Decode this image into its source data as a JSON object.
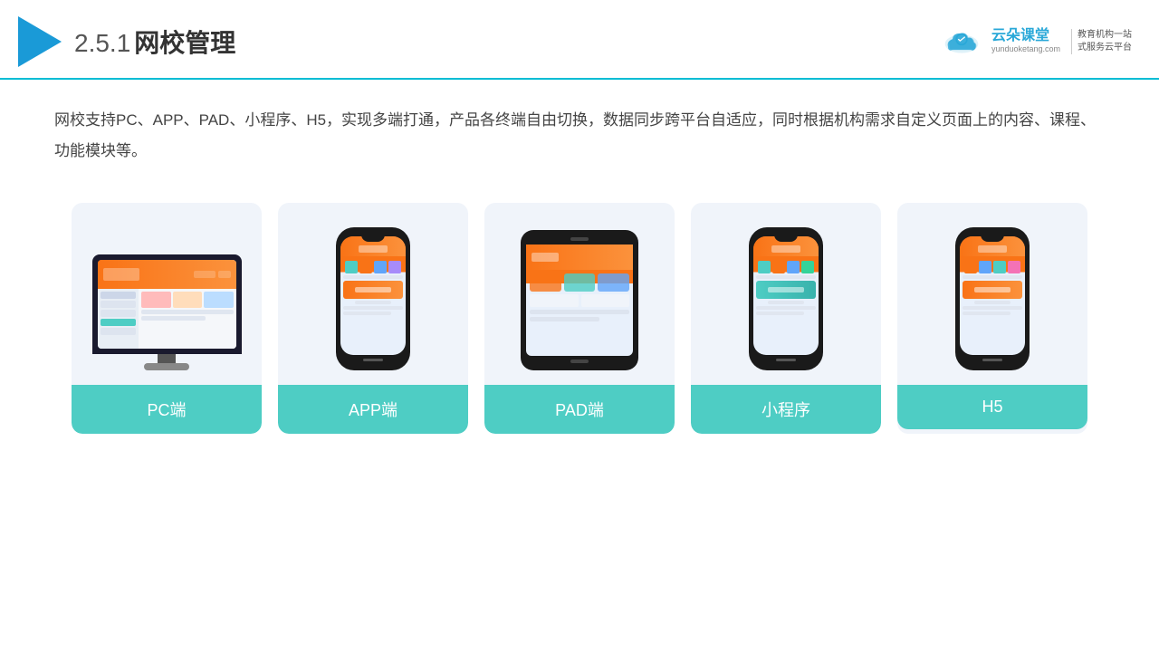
{
  "header": {
    "title_num": "2.5.1",
    "title_cn": "网校管理",
    "brand_name": "云朵课堂",
    "brand_url": "yunduoketang.com",
    "brand_slogan": "教育机构一站\n式服务云平台"
  },
  "description": "网校支持PC、APP、PAD、小程序、H5，实现多端打通，产品各终端自由切换，数据同步跨平台自适应，同时根据机构需求自定义页面上的内容、课程、功能模块等。",
  "cards": [
    {
      "id": "pc",
      "label": "PC端",
      "type": "monitor"
    },
    {
      "id": "app",
      "label": "APP端",
      "type": "phone"
    },
    {
      "id": "pad",
      "label": "PAD端",
      "type": "tablet"
    },
    {
      "id": "mini",
      "label": "小程序",
      "type": "phone2"
    },
    {
      "id": "h5",
      "label": "H5",
      "type": "phone3"
    }
  ],
  "colors": {
    "accent": "#4ecdc4",
    "header_line": "#00bcd4",
    "logo_blue": "#1a9ad7",
    "text_dark": "#333",
    "card_bg": "#f0f4fa"
  }
}
